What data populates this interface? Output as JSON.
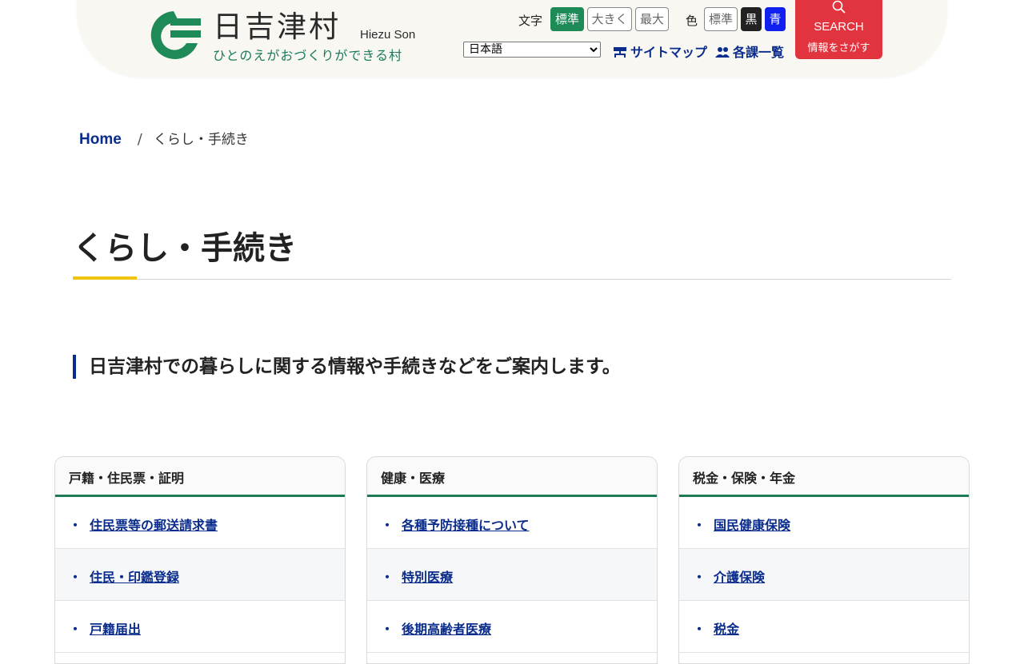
{
  "header": {
    "logo_title": "日吉津村",
    "logo_en": "Hiezu Son",
    "logo_tagline": "ひとのえがおづくりができる村",
    "font_size_label": "文字",
    "font_size_buttons": [
      "標準",
      "大きく",
      "最大"
    ],
    "color_label": "色",
    "color_buttons": [
      "標準",
      "黒",
      "青"
    ],
    "language_selected": "日本語",
    "sitemap_label": "サイトマップ",
    "departments_label": "各課一覧",
    "search_en": "SEARCH",
    "search_ja": "情報をさがす"
  },
  "breadcrumb": {
    "home": "Home",
    "separator": "/",
    "current": "くらし・手続き"
  },
  "page": {
    "title": "くらし・手続き",
    "lead": "日吉津村での暮らしに関する情報や手続きなどをご案内します。"
  },
  "cards": [
    {
      "heading": "戸籍・住民票・証明",
      "items": [
        "住民票等の郵送請求書",
        "住民・印鑑登録",
        "戸籍届出"
      ]
    },
    {
      "heading": "健康・医療",
      "items": [
        "各種予防接種について",
        "特別医療",
        "後期高齢者医療"
      ]
    },
    {
      "heading": "税金・保険・年金",
      "items": [
        "国民健康保険",
        "介護保険",
        "税金"
      ]
    }
  ],
  "colors": {
    "brand_green": "#1e8a57",
    "link_navy": "#0a2c8c",
    "search_red": "#e2343f",
    "accent_yellow": "#f1c40f"
  }
}
